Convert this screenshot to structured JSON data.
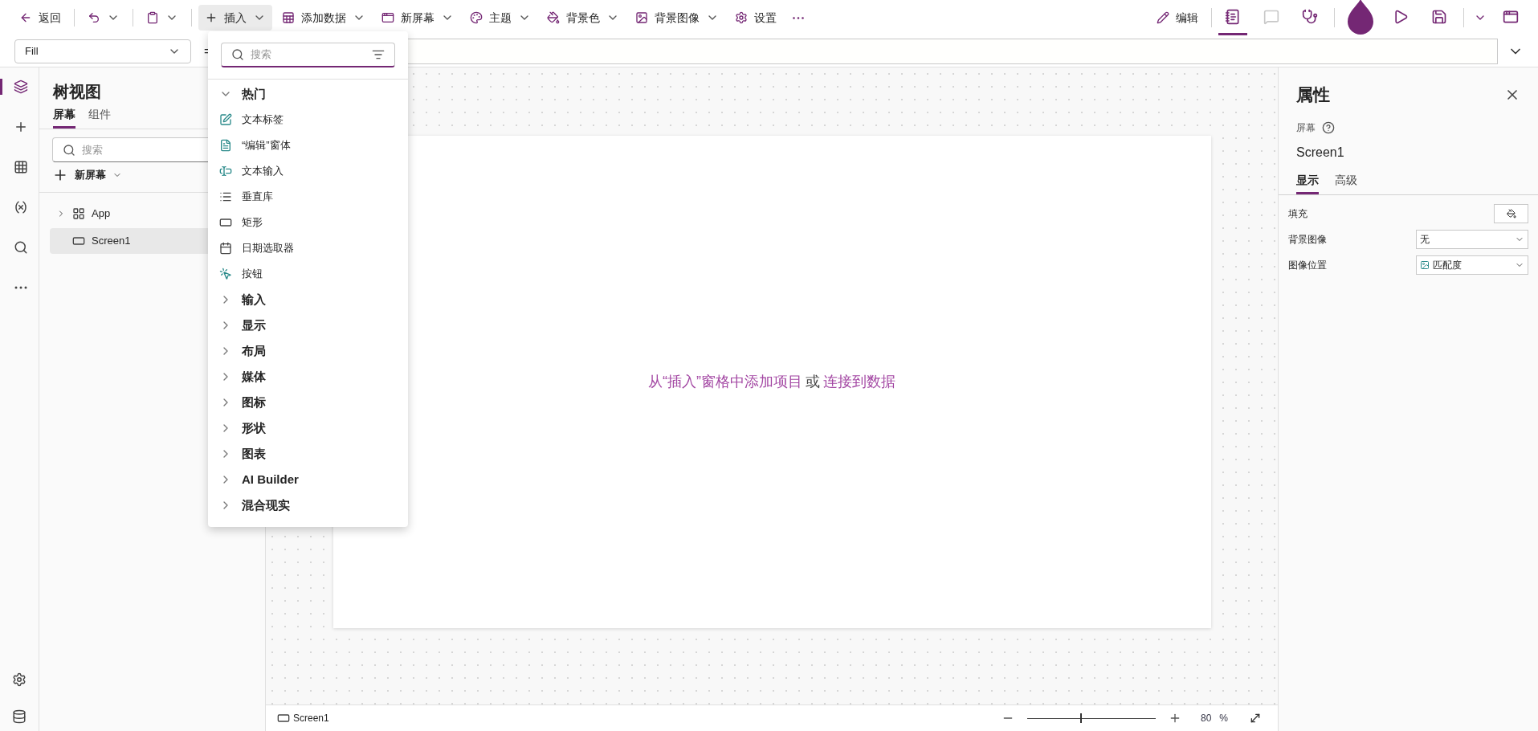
{
  "toolbar": {
    "left": [
      {
        "kind": "back",
        "label": "返回",
        "caret": false,
        "selected": false
      },
      {
        "kind": "undo",
        "caret": true,
        "selected": false
      },
      {
        "kind": "paste",
        "caret": true,
        "selected": false
      },
      {
        "kind": "insert",
        "label": "插入",
        "caret": true,
        "selected": true
      },
      {
        "kind": "data",
        "label": "添加数据",
        "caret": true,
        "selected": false
      },
      {
        "kind": "screen",
        "label": "新屏幕",
        "caret": true,
        "selected": false
      },
      {
        "kind": "theme",
        "label": "主题",
        "caret": true,
        "selected": false
      },
      {
        "kind": "bgcolor",
        "label": "背景色",
        "caret": true,
        "selected": false
      },
      {
        "kind": "bgimage",
        "label": "背景图像",
        "caret": true,
        "selected": false
      },
      {
        "kind": "settings",
        "label": "设置",
        "caret": false,
        "selected": false
      },
      {
        "kind": "more",
        "caret": false,
        "selected": false
      }
    ],
    "edit_label": "编辑",
    "right": [
      {
        "kind": "checker",
        "selected": true,
        "disabled": false
      },
      {
        "kind": "comments",
        "selected": false,
        "disabled": true
      },
      {
        "kind": "monitor",
        "selected": false,
        "disabled": false
      },
      {
        "kind": "avatar",
        "selected": false,
        "disabled": false
      },
      {
        "kind": "play",
        "selected": false,
        "disabled": false
      },
      {
        "kind": "save",
        "selected": false,
        "disabled": false
      },
      {
        "kind": "publish",
        "selected": false,
        "disabled": false
      }
    ]
  },
  "formula_bar": {
    "property": "Fill",
    "equals": "="
  },
  "rail": {
    "items": [
      {
        "kind": "tree",
        "selected": true
      },
      {
        "kind": "insert",
        "selected": false
      },
      {
        "kind": "data",
        "selected": false
      },
      {
        "kind": "variables",
        "selected": false
      },
      {
        "kind": "search",
        "selected": false
      },
      {
        "kind": "more",
        "selected": false
      }
    ],
    "bottom": [
      {
        "kind": "settings"
      },
      {
        "kind": "account"
      }
    ]
  },
  "tree_view": {
    "title": "树视图",
    "tabs": [
      {
        "label": "屏幕",
        "selected": true
      },
      {
        "label": "组件",
        "selected": false
      }
    ],
    "search": {
      "placeholder": "搜索"
    },
    "new_screen": "新屏幕",
    "items": [
      {
        "kind": "app",
        "label": "App",
        "expanded": false,
        "selected": false
      },
      {
        "kind": "screen",
        "label": "Screen1",
        "selected": true
      }
    ]
  },
  "insert_menu": {
    "search": {
      "placeholder": "搜索"
    },
    "sections": [
      {
        "label": "热门",
        "expanded": true,
        "items": [
          {
            "kind": "label",
            "label": "文本标签"
          },
          {
            "kind": "form",
            "label": "“编辑”窗体"
          },
          {
            "kind": "textinput",
            "label": "文本输入"
          },
          {
            "kind": "gallery",
            "label": "垂直库"
          },
          {
            "kind": "rectangle",
            "label": "矩形"
          },
          {
            "kind": "date",
            "label": "日期选取器"
          },
          {
            "kind": "button",
            "label": "按钮"
          }
        ]
      },
      {
        "label": "输入",
        "expanded": false
      },
      {
        "label": "显示",
        "expanded": false
      },
      {
        "label": "布局",
        "expanded": false
      },
      {
        "label": "媒体",
        "expanded": false
      },
      {
        "label": "图标",
        "expanded": false
      },
      {
        "label": "形状",
        "expanded": false
      },
      {
        "label": "图表",
        "expanded": false
      },
      {
        "label": "AI Builder",
        "expanded": false
      },
      {
        "label": "混合现实",
        "expanded": false
      }
    ]
  },
  "canvas": {
    "hint": {
      "insert_link": "从“插入”窗格中添加项目",
      "middle": "或",
      "data_link": "连接到数据"
    }
  },
  "status_bar": {
    "screen": "Screen1",
    "zoom": {
      "level": 0.41,
      "value": "80",
      "unit": "%"
    }
  },
  "properties": {
    "title": "属性",
    "type_label": "屏幕",
    "name": "Screen1",
    "tabs": [
      {
        "label": "显示",
        "selected": true
      },
      {
        "label": "高级",
        "selected": false
      }
    ],
    "rows": [
      {
        "kind": "color",
        "label": "填充"
      },
      {
        "kind": "select",
        "label": "背景图像",
        "value": "无"
      },
      {
        "kind": "image_select",
        "label": "图像位置",
        "value": "匹配度"
      }
    ]
  }
}
